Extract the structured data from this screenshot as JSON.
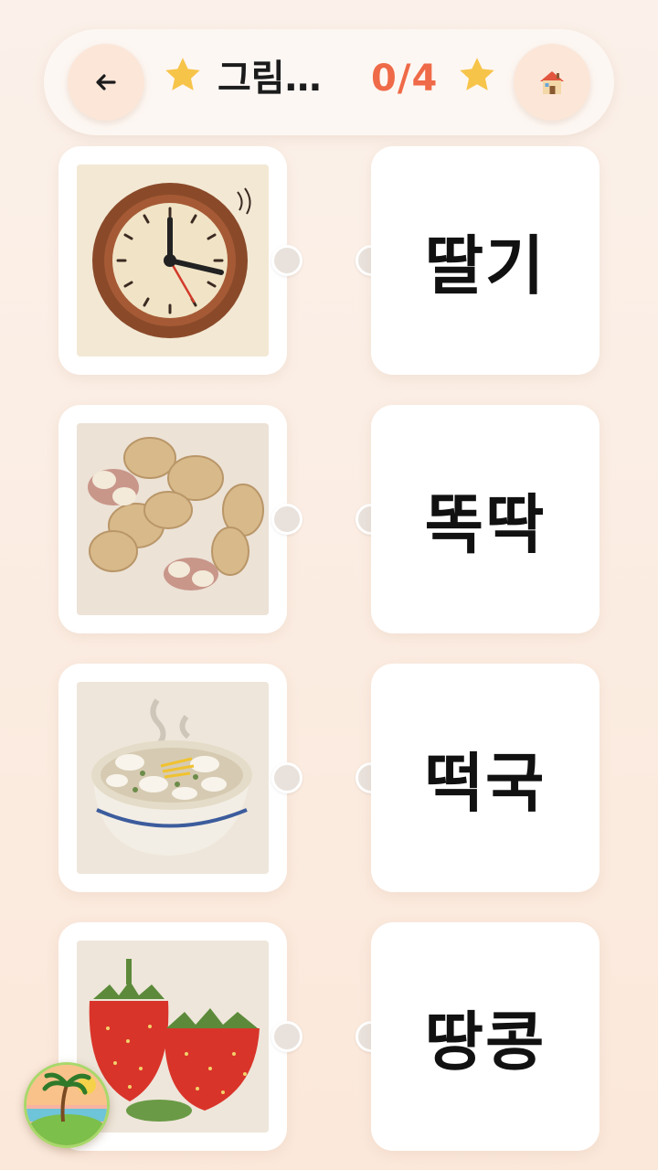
{
  "header": {
    "back_icon": "arrow-left-icon",
    "title": "그림…",
    "score": "0/4",
    "star_color": "#f7c44a",
    "score_color": "#ef6a48",
    "home_icon": "house-icon"
  },
  "pictures": [
    {
      "name": "clock",
      "icon": "felt-clock-image"
    },
    {
      "name": "peanuts",
      "icon": "felt-peanuts-image"
    },
    {
      "name": "rice-cake-soup",
      "icon": "felt-tteokguk-image"
    },
    {
      "name": "strawberries",
      "icon": "felt-strawberries-image"
    }
  ],
  "words": [
    "딸기",
    "똑딱",
    "떡국",
    "땅콩"
  ],
  "badge": {
    "icon": "island-logo-icon"
  }
}
